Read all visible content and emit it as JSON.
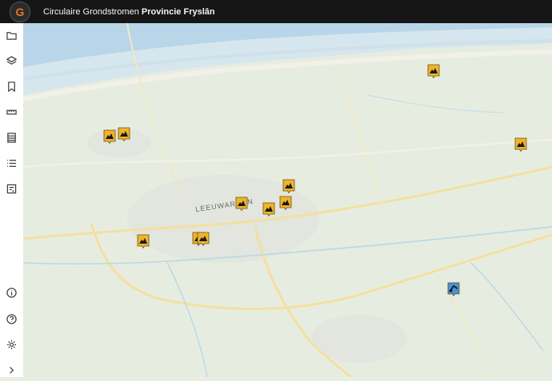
{
  "header": {
    "title_prefix": "Circulaire Grondstromen",
    "title_bold": "Provincie Fryslân"
  },
  "sidebar": {
    "top_items": [
      {
        "name": "folder-icon"
      },
      {
        "name": "layers-icon"
      },
      {
        "name": "bookmark-icon"
      },
      {
        "name": "ruler-icon"
      },
      {
        "name": "table-icon"
      },
      {
        "name": "list-icon"
      },
      {
        "name": "report-icon"
      }
    ],
    "bottom_items": [
      {
        "name": "info-icon"
      },
      {
        "name": "help-icon"
      },
      {
        "name": "settings-icon"
      },
      {
        "name": "expand-chevron-icon"
      }
    ]
  },
  "map": {
    "city_label": "LEEUWARDEN",
    "markers": [
      {
        "type": "soil-pile",
        "color": "#f0b429"
      },
      {
        "type": "soil-pile",
        "color": "#f0b429"
      },
      {
        "type": "soil-pile",
        "color": "#f0b429"
      },
      {
        "type": "soil-pile",
        "color": "#f0b429"
      },
      {
        "type": "soil-pile",
        "color": "#f0b429"
      },
      {
        "type": "soil-pile",
        "color": "#f0b429"
      },
      {
        "type": "soil-pile",
        "color": "#f0b429"
      },
      {
        "type": "soil-pile",
        "color": "#f0b429"
      },
      {
        "type": "soil-pile",
        "color": "#f0b429"
      },
      {
        "type": "soil-pile",
        "color": "#f0b429"
      },
      {
        "type": "soil-pile",
        "color": "#f0b429"
      },
      {
        "type": "excavator",
        "color": "#4a90d9"
      }
    ]
  }
}
